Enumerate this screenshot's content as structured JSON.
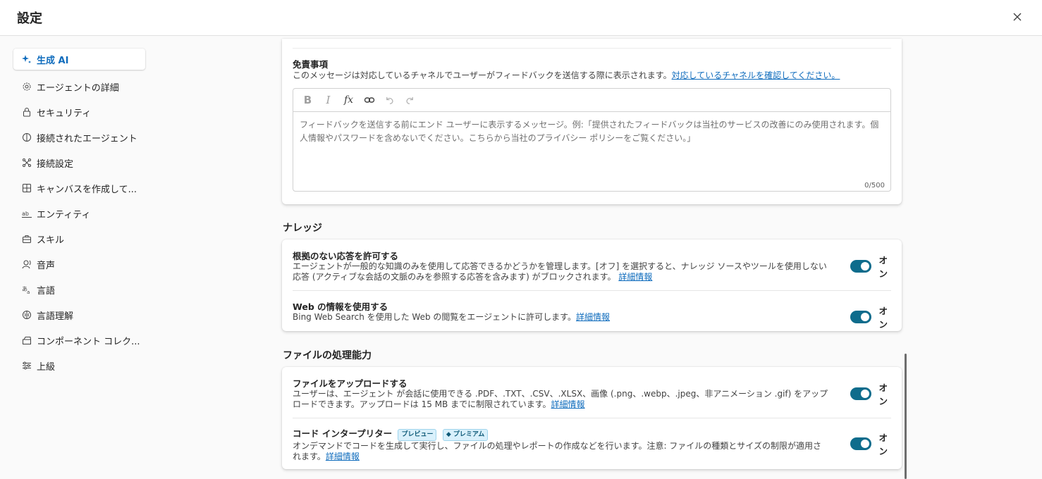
{
  "header": {
    "title": "設定",
    "close_icon": "close-icon"
  },
  "sidebar": {
    "items": [
      {
        "label": "生成 AI",
        "icon": "sparkle-icon",
        "active": true
      },
      {
        "label": "エージェントの詳細",
        "icon": "gear-icon"
      },
      {
        "label": "セキュリティ",
        "icon": "lock-icon"
      },
      {
        "label": "接続されたエージェント",
        "icon": "connected-agent-icon"
      },
      {
        "label": "接続設定",
        "icon": "connection-icon"
      },
      {
        "label": "キャンバスを作成して...",
        "icon": "grid-icon"
      },
      {
        "label": "エンティティ",
        "icon": "entity-icon"
      },
      {
        "label": "スキル",
        "icon": "toolbox-icon"
      },
      {
        "label": "音声",
        "icon": "voice-icon"
      },
      {
        "label": "言語",
        "icon": "translate-icon"
      },
      {
        "label": "言語理解",
        "icon": "brain-icon"
      },
      {
        "label": "コンポーネント コレク...",
        "icon": "box-icon"
      },
      {
        "label": "上級",
        "icon": "sliders-icon"
      }
    ]
  },
  "disclaimer": {
    "title": "免責事項",
    "description": "このメッセージは対応しているチャネルでユーザーがフィードバックを送信する際に表示されます。",
    "link": "対応しているチャネルを確認してください。",
    "placeholder": "フィードバックを送信する前にエンド ユーザーに表示するメッセージ。例:「提供されたフィードバックは当社のサービスの改善にのみ使用されます。個人情報やパスワードを含めないでください。こちらから当社のプライバシー ポリシーをご覧ください。」",
    "counter": "0/500",
    "toolbar": [
      "bold-icon",
      "italic-icon",
      "formula-icon",
      "link-icon",
      "undo-icon",
      "redo-icon"
    ]
  },
  "knowledge": {
    "title": "ナレッジ",
    "rows": [
      {
        "title": "根拠のない応答を許可する",
        "description": "エージェントが一般的な知識のみを使用して応答できるかどうかを管理します。[オフ] を選択すると、ナレッジ ソースやツールを使用しない応答 (アクティブな会話の文脈のみを参照する応答を含みます) がブロックされます。",
        "link": "詳細情報",
        "toggle": "オン"
      },
      {
        "title": "Web の情報を使用する",
        "description": "Bing Web Search を使用した Web の閲覧をエージェントに許可します。",
        "link": "詳細情報",
        "toggle": "オン"
      }
    ]
  },
  "files": {
    "title": "ファイルの処理能力",
    "rows": [
      {
        "title": "ファイルをアップロードする",
        "description": "ユーザーは、エージェント が会話に使用できる .PDF、.TXT、.CSV、.XLSX、画像 (.png、.webp、.jpeg、非アニメーション .gif) をアップロードできます。アップロードは 15 MB までに制限されています。",
        "link": "詳細情報",
        "toggle": "オン"
      },
      {
        "title": "コード インタープリター",
        "badge_preview": "プレビュー",
        "badge_premium": "プレミアム",
        "description": "オンデマンドでコードを生成して実行し、ファイルの処理やレポートの作成などを行います。注意: ファイルの種類とサイズの制限が適用されます。",
        "link": "詳細情報",
        "toggle": "オン"
      }
    ]
  },
  "colors": {
    "accent": "#0e6c8c",
    "link": "#0f6cbd"
  }
}
